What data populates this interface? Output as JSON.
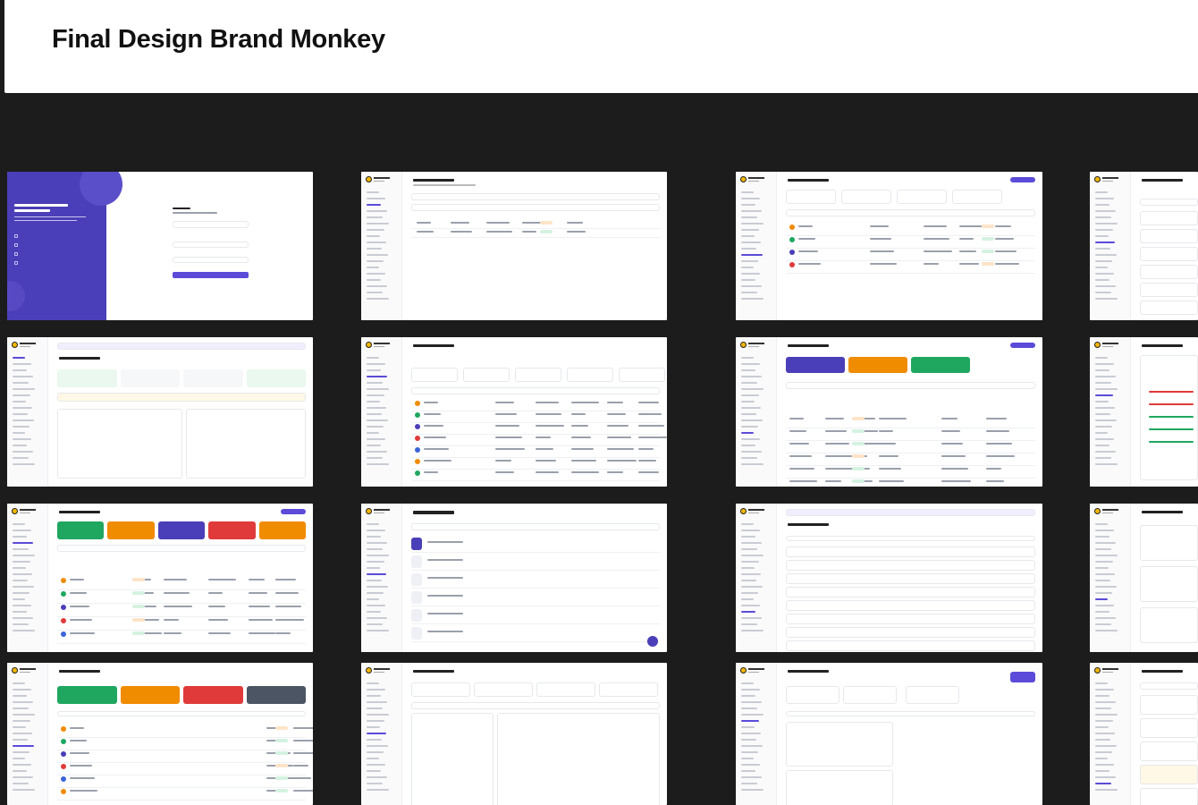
{
  "page": {
    "title": "Final Design Brand Monkey",
    "background": "#1c1c1c",
    "accent": "#5b4bd8"
  },
  "frames": [
    {
      "name": "frame-sign-in"
    },
    {
      "name": "frame-request-inbox"
    },
    {
      "name": "frame-tasks"
    },
    {
      "name": "frame-minutes-of-meeting"
    },
    {
      "name": "frame-dashboard"
    },
    {
      "name": "frame-attendance-overview"
    },
    {
      "name": "frame-client-directory"
    },
    {
      "name": "frame-onboarding"
    },
    {
      "name": "frame-employee-directory"
    },
    {
      "name": "frame-meetings"
    },
    {
      "name": "frame-notifications"
    },
    {
      "name": "frame-team-structure"
    },
    {
      "name": "frame-daily-logs"
    },
    {
      "name": "frame-minutes-of-meeting-2"
    },
    {
      "name": "frame-holiday-calendar"
    },
    {
      "name": "frame-roles-permissions"
    }
  ],
  "card_colors": {
    "purple": "#4a3fb8",
    "orange": "#f08c00",
    "green": "#1fa760",
    "red": "#e03a3a",
    "slate": "#4b5563",
    "blue": "#3b63d9",
    "yellow": "#f2b705"
  }
}
